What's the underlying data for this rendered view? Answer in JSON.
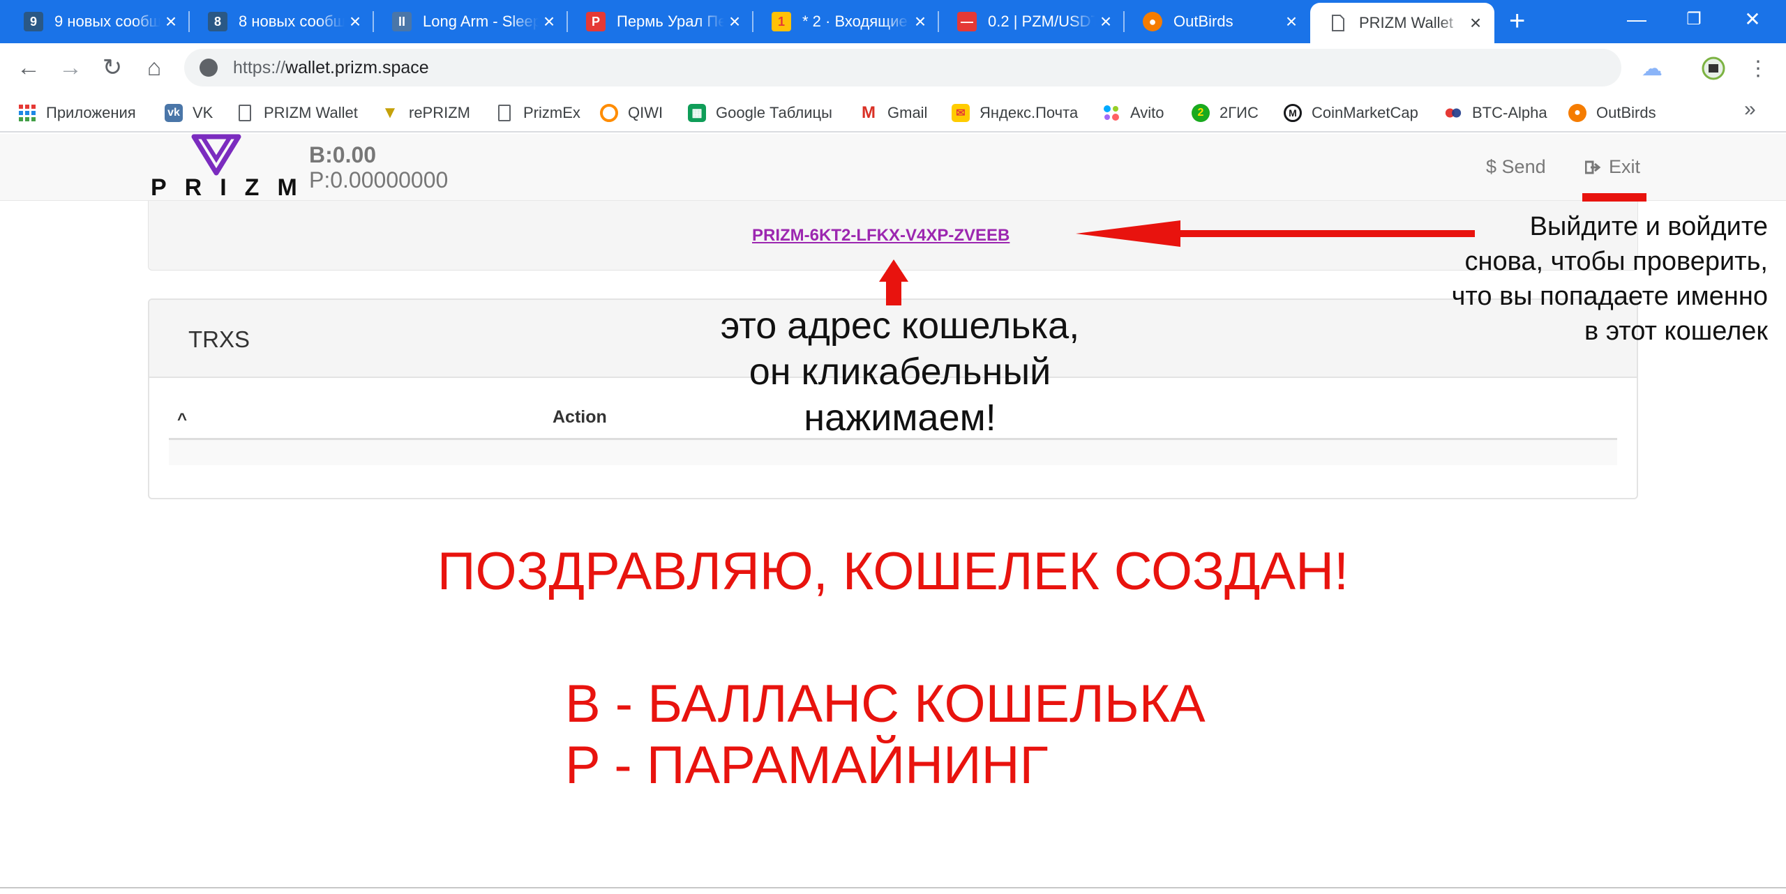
{
  "browser": {
    "tabs": [
      {
        "favicon_text": "9",
        "favicon_color": "#2a5885",
        "title": "9 новых сообщений"
      },
      {
        "favicon_text": "8",
        "favicon_color": "#2a5885",
        "title": "8 новых сообщений"
      },
      {
        "favicon_text": "II",
        "favicon_color": "#4a76a8",
        "title": "Long Arm - Sleep"
      },
      {
        "favicon_text": "P",
        "favicon_color": "#e53935",
        "title": "Пермь Урал Пермь"
      },
      {
        "favicon_text": "1",
        "favicon_color": "#ffc107",
        "title": "* 2 · Входящие"
      },
      {
        "favicon_text": "—",
        "favicon_color": "#e53935",
        "title": "0.2 | PZM/USDT"
      },
      {
        "favicon_text": "●",
        "favicon_color": "#f57c00",
        "title": "OutBirds"
      },
      {
        "favicon_text": "",
        "favicon_color": "",
        "title": "PRIZM Wallet"
      }
    ],
    "address_bar": {
      "scheme": "https://",
      "host": "wallet.prizm.space"
    },
    "bookmarks": [
      {
        "label": "Приложения",
        "icon": "apps-grid-icon",
        "color": "#e53935"
      },
      {
        "label": "VK",
        "icon": "vk-icon",
        "color": "#4a76a8"
      },
      {
        "label": "PRIZM Wallet",
        "icon": "page-icon",
        "color": ""
      },
      {
        "label": "rePRIZM",
        "icon": "reprizm-icon",
        "color": "#c5a10a"
      },
      {
        "label": "PrizmEx",
        "icon": "page-icon",
        "color": ""
      },
      {
        "label": "QIWI",
        "icon": "qiwi-icon",
        "color": "#ff8c00"
      },
      {
        "label": "Google Таблицы",
        "icon": "sheets-icon",
        "color": "#0f9d58"
      },
      {
        "label": "Gmail",
        "icon": "gmail-icon",
        "color": "#d93025"
      },
      {
        "label": "Яндекс.Почта",
        "icon": "yandex-mail-icon",
        "color": "#ffcc00"
      },
      {
        "label": "Avito",
        "icon": "avito-icon",
        "color": "#00aaff"
      },
      {
        "label": "2ГИС",
        "icon": "2gis-icon",
        "color": "#19aa1e"
      },
      {
        "label": "CoinMarketCap",
        "icon": "coinmarketcap-icon",
        "color": "#17181b"
      },
      {
        "label": "BTC-Alpha",
        "icon": "btc-alpha-icon",
        "color": "#e53935"
      },
      {
        "label": "OutBirds",
        "icon": "outbirds-icon",
        "color": "#f57c00"
      }
    ]
  },
  "wallet": {
    "logo_text": "PRIZM",
    "balance_b": "B:0.00",
    "balance_p": "P:0.00000000",
    "nav_send": "Send",
    "nav_exit": "Exit",
    "address": "PRIZM-6KT2-LFKX-V4XP-ZVEEB",
    "trx_title": "TRXS",
    "table_headers": [
      "^",
      "Action"
    ]
  },
  "annotations": {
    "exit_note": [
      "Выйдите и войдите",
      "снова, чтобы проверить,",
      "что вы попадаете именно",
      "в этот кошелек"
    ],
    "address_note": [
      "это адрес кошелька,",
      "он кликабельный",
      "нажимаем!"
    ],
    "congrats": "ПОЗДРАВЛЯЮ, КОШЕЛЕК СОЗДАН!",
    "legend": [
      "B - БАЛЛАНС КОШЕЛЬКА",
      "P - ПАРАМАЙНИНГ"
    ],
    "accent_color": "#e8130e"
  }
}
